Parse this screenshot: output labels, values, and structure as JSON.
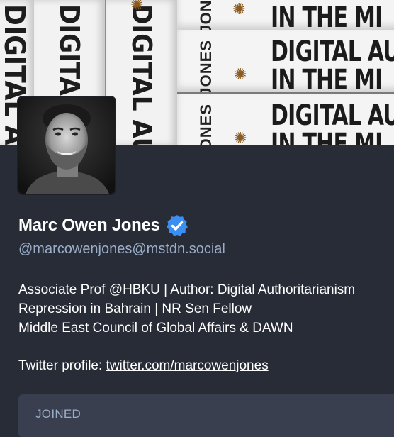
{
  "header": {
    "spines_vertical": [
      "DIGITAL AUTHO",
      "DIGITAL AUTH IN THE",
      "DIGITAL AUTH IN THE MI"
    ],
    "spines_horizontal": [
      {
        "line1": "IN THE MI",
        "line2": "",
        "author": "JONES"
      },
      {
        "line1": "DIGITAL AUTH",
        "line2": "IN THE MI",
        "author": "JONES"
      },
      {
        "line1": "DIGITAL AUTHO",
        "line2": "IN THE MI",
        "author": "JONES"
      }
    ]
  },
  "profile": {
    "display_name": "Marc Owen Jones",
    "handle": "@marcowenjones@mstdn.social",
    "bio_lines": [
      "Associate Prof @HBKU | Author: Digital Authoritarianism",
      "Repression in Bahrain | NR Sen Fellow",
      "Middle East Council of Global Affairs & DAWN"
    ],
    "twitter_prefix": "Twitter profile: ",
    "twitter_link": "twitter.com/marcowenjones",
    "joined_label": "JOINED"
  },
  "colors": {
    "background": "#282c37",
    "handle": "#9baec8",
    "verified": "#3b8ff3",
    "joined_box": "#393f4f"
  },
  "icons": {
    "verified": "verified-check-icon",
    "bee": "bee-icon"
  }
}
